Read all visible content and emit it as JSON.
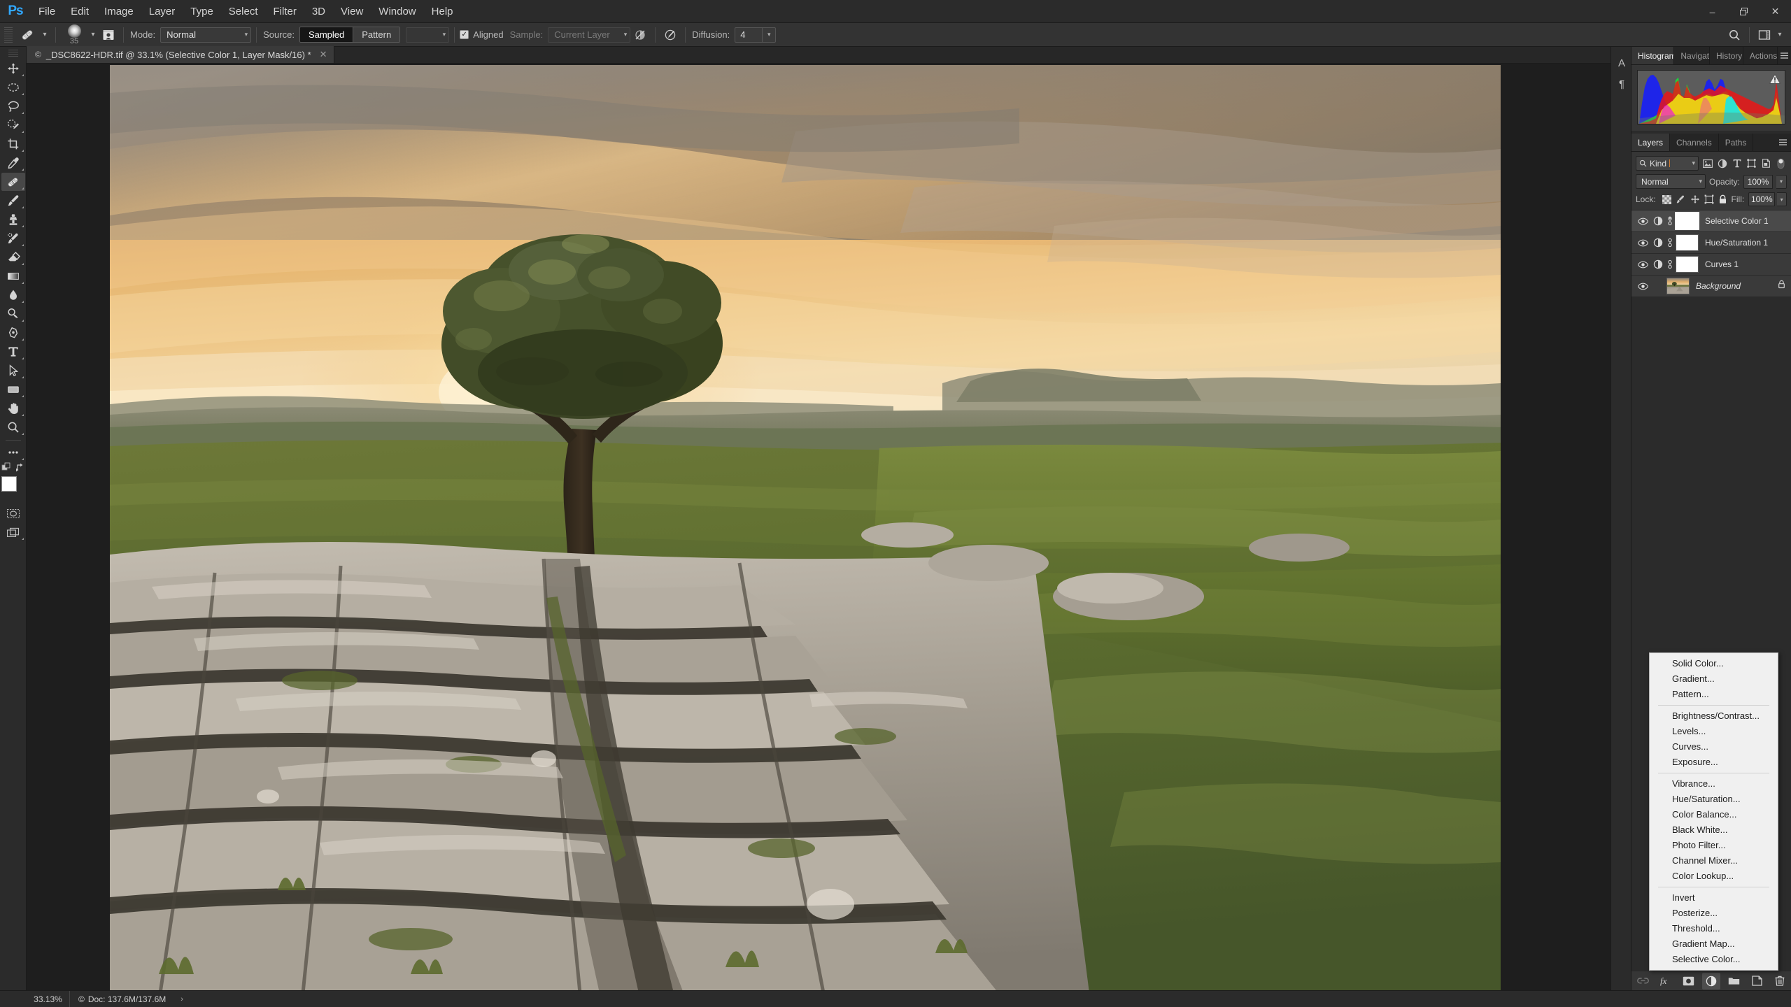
{
  "app": {
    "name": "Adobe Photoshop",
    "logo": "Ps"
  },
  "menubar": {
    "items": [
      {
        "label": "File"
      },
      {
        "label": "Edit"
      },
      {
        "label": "Image"
      },
      {
        "label": "Layer"
      },
      {
        "label": "Type"
      },
      {
        "label": "Select"
      },
      {
        "label": "Filter"
      },
      {
        "label": "3D"
      },
      {
        "label": "View"
      },
      {
        "label": "Window"
      },
      {
        "label": "Help"
      }
    ],
    "window_controls": {
      "minimize": "–",
      "restore": "❐",
      "close": "✕"
    }
  },
  "options_bar": {
    "tool_icon": "healing-brush-icon",
    "brush_size": "35",
    "mode_label": "Mode:",
    "mode_value": "Normal",
    "source_label": "Source:",
    "source_options": [
      "Sampled",
      "Pattern"
    ],
    "source_selected": "Sampled",
    "aligned_label": "Aligned",
    "aligned_checked": true,
    "sample_label": "Sample:",
    "sample_value": "Current Layer",
    "diffusion_label": "Diffusion:",
    "diffusion_value": "4",
    "right_icons": [
      "search-icon",
      "workspace-switcher-icon"
    ]
  },
  "toolbar": {
    "tools": [
      {
        "name": "move-tool",
        "title": "Move Tool"
      },
      {
        "name": "marquee-tool",
        "title": "Rectangular Marquee Tool"
      },
      {
        "name": "lasso-tool",
        "title": "Lasso Tool"
      },
      {
        "name": "quick-selection-tool",
        "title": "Quick Selection Tool"
      },
      {
        "name": "crop-tool",
        "title": "Crop Tool"
      },
      {
        "name": "eyedropper-tool",
        "title": "Eyedropper Tool"
      },
      {
        "name": "healing-brush-tool",
        "title": "Healing Brush Tool",
        "active": true
      },
      {
        "name": "brush-tool",
        "title": "Brush Tool"
      },
      {
        "name": "clone-stamp-tool",
        "title": "Clone Stamp Tool"
      },
      {
        "name": "history-brush-tool",
        "title": "History Brush Tool"
      },
      {
        "name": "eraser-tool",
        "title": "Eraser Tool"
      },
      {
        "name": "gradient-tool",
        "title": "Gradient Tool"
      },
      {
        "name": "blur-tool",
        "title": "Blur Tool"
      },
      {
        "name": "dodge-tool",
        "title": "Dodge Tool"
      },
      {
        "name": "pen-tool",
        "title": "Pen Tool"
      },
      {
        "name": "type-tool",
        "title": "Horizontal Type Tool"
      },
      {
        "name": "path-selection-tool",
        "title": "Path Selection Tool"
      },
      {
        "name": "rectangle-tool",
        "title": "Rectangle Tool"
      },
      {
        "name": "hand-tool",
        "title": "Hand Tool"
      },
      {
        "name": "zoom-tool",
        "title": "Zoom Tool"
      },
      {
        "name": "edit-toolbar-tool",
        "title": "Edit Toolbar"
      }
    ],
    "foreground_color": "#ffffff",
    "background_color": "#000000"
  },
  "document": {
    "tab_title": "_DSC8622-HDR.tif @ 33.1% (Selective Color 1, Layer Mask/16) *",
    "copyright_mark": "©",
    "close_glyph": "✕"
  },
  "panels": {
    "top_group": {
      "tabs": [
        {
          "label": "Histogram",
          "active": true
        },
        {
          "label": "Navigat",
          "active": false
        },
        {
          "label": "History",
          "active": false
        },
        {
          "label": "Actions",
          "active": false
        }
      ],
      "menu_icon": "panel-menu-icon",
      "histogram": {
        "warning": true,
        "channel": "RGB"
      }
    },
    "layers_group": {
      "tabs": [
        {
          "label": "Layers",
          "active": true
        },
        {
          "label": "Channels",
          "active": false
        },
        {
          "label": "Paths",
          "active": false
        }
      ],
      "menu_icon": "panel-menu-icon",
      "filter": {
        "kind_label": "Kind",
        "filter_icons": [
          "pixel-filter-icon",
          "adjustment-filter-icon",
          "type-filter-icon",
          "shape-filter-icon",
          "smart-object-filter-icon"
        ],
        "toggle_icon": "filter-toggle-icon"
      },
      "blend_mode": "Normal",
      "opacity_label": "Opacity:",
      "opacity_value": "100%",
      "lock_label": "Lock:",
      "lock_icons": [
        "lock-transparent-pixels-icon",
        "lock-image-pixels-icon",
        "lock-position-icon",
        "lock-artboard-icon",
        "lock-all-icon"
      ],
      "fill_label": "Fill:",
      "fill_value": "100%",
      "layers": [
        {
          "name": "Selective Color 1",
          "visible": true,
          "selected": true,
          "type": "adjustment",
          "linked": true,
          "mask_selected": true
        },
        {
          "name": "Hue/Saturation 1",
          "visible": true,
          "selected": false,
          "type": "adjustment",
          "linked": true,
          "mask_selected": false
        },
        {
          "name": "Curves 1",
          "visible": true,
          "selected": false,
          "type": "adjustment",
          "linked": true,
          "mask_selected": false
        },
        {
          "name": "Background",
          "visible": true,
          "selected": false,
          "type": "image",
          "locked": true,
          "italic": true
        }
      ],
      "footer_buttons": [
        {
          "name": "link-layers-button",
          "icon": "link-icon",
          "disabled": true
        },
        {
          "name": "layer-style-button",
          "icon": "fx-icon"
        },
        {
          "name": "add-layer-mask-button",
          "icon": "mask-icon"
        },
        {
          "name": "new-adjustment-layer-button",
          "icon": "half-circle-icon",
          "pressed": true
        },
        {
          "name": "new-group-button",
          "icon": "folder-icon"
        },
        {
          "name": "new-layer-button",
          "icon": "new-layer-icon"
        },
        {
          "name": "delete-layer-button",
          "icon": "trash-icon"
        }
      ]
    },
    "dock_strip_icons": [
      {
        "name": "character-panel-icon",
        "glyph": "A"
      },
      {
        "name": "paragraph-panel-icon",
        "glyph": "¶"
      }
    ]
  },
  "adjustment_menu": {
    "groups": [
      {
        "items": [
          "Solid Color...",
          "Gradient...",
          "Pattern..."
        ]
      },
      {
        "items": [
          "Brightness/Contrast...",
          "Levels...",
          "Curves...",
          "Exposure..."
        ]
      },
      {
        "items": [
          "Vibrance...",
          "Hue/Saturation...",
          "Color Balance...",
          "Black  White...",
          "Photo Filter...",
          "Channel Mixer...",
          "Color Lookup..."
        ]
      },
      {
        "items": [
          "Invert",
          "Posterize...",
          "Threshold...",
          "Gradient Map...",
          "Selective Color..."
        ]
      }
    ]
  },
  "statusbar": {
    "zoom": "33.13%",
    "doc_prefix": "©",
    "doc_label": "Doc: 137.6M/137.6M",
    "arrow": "›"
  },
  "colors": {
    "accent": "#31a8ff",
    "panel_bg": "#363636",
    "chrome_bg": "#2b2b2b",
    "canvas_bg": "#1e1e1e",
    "menu_light_bg": "#f0f0f0"
  }
}
